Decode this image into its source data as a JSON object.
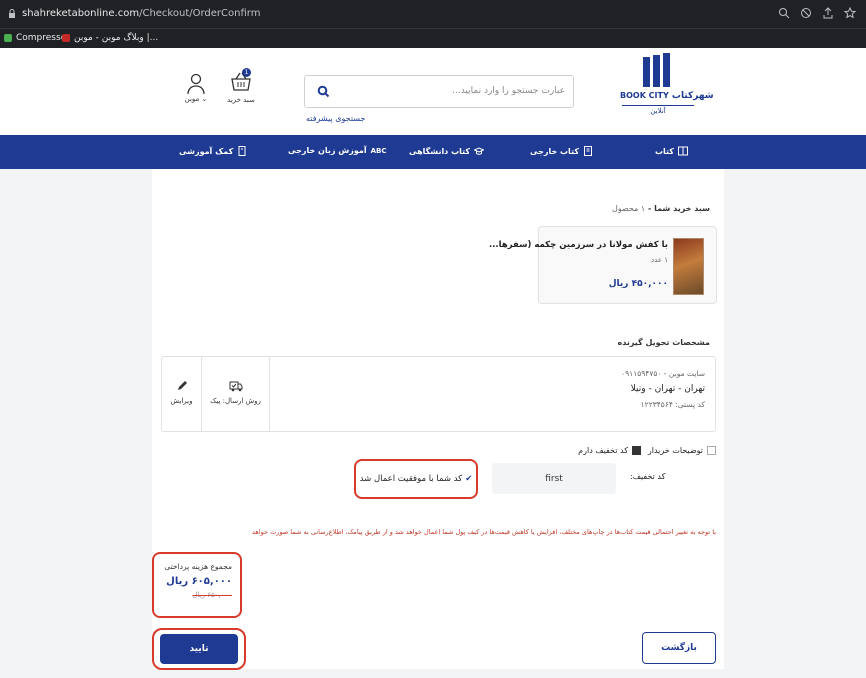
{
  "browser": {
    "url_host": "shahreketabonline.com",
    "url_path": "/Checkout/OrderConfirm",
    "bookmarks": [
      {
        "label": "Compressor",
        "icon": "compressor-icon"
      },
      {
        "label": "وبلاگ موبن - موبن |...",
        "icon": "blog-icon"
      }
    ]
  },
  "header": {
    "logo_fa": "شهرکتاب",
    "logo_en": "BOOK CITY",
    "logo_sub": "آنلاین",
    "search_placeholder": "عبارت جستجو را وارد نمایید...",
    "advanced_search": "جستجوی پیشرفته",
    "cart_label": "سبد خرید",
    "cart_count": "1",
    "account_label": "موبن"
  },
  "nav": {
    "items": [
      {
        "label": "کتاب",
        "icon": "book-icon"
      },
      {
        "label": "کتاب خارجی",
        "icon": "foreign-book-icon"
      },
      {
        "label": "کتاب دانشگاهی",
        "icon": "graduation-icon"
      },
      {
        "label": "آموزش زبان خارجی",
        "icon": "abc-icon"
      },
      {
        "label": "کمک آموزشی",
        "icon": "notebook-icon"
      }
    ]
  },
  "cart": {
    "title": "سبد خرید شما",
    "count_text": "۱ محصول",
    "product_name": "با کفش مولانا در سرزمین چکمه (سفرها...",
    "product_qty": "۱ عدد",
    "product_price": "۴۵۰,۰۰۰ ریال"
  },
  "delivery": {
    "title": "مشخصات تحویل گیرنده",
    "recipient": "سایت موبن - ۰۹۱۱۵۹۴۷۵۰",
    "address": "تهران - تهران - ونیلا",
    "postal": "کد پستی: ۱۲۲۳۴۵۶۴",
    "method_label": "روش ارسال: پیک",
    "edit_label": "ویرایش"
  },
  "options": {
    "buyer_notes_label": "توضیحات خریدار",
    "buyer_notes_checked": false,
    "has_coupon_label": "کد تخفیف دارم",
    "has_coupon_checked": true,
    "coupon_label": "کد تخفیف:",
    "coupon_value": "first",
    "coupon_success": "کد شما با موفقیت اعمال شد"
  },
  "notice": "با توجه به تغییر احتمالی قیمت کتاب‌ها در چاپ‌های مختلف، افزایش یا کاهش قیمت‌ها در کیف پول شما اعمال خواهد شد و از طریق پیامک، اطلاع‌رسانی به شما صورت خواهد گرفت.",
  "summary": {
    "total_label": "مجموع هزینه پرداختی",
    "total_value": "۶۰۵,۰۰۰ ریال",
    "old_value": "۶۵۰,۰۰۰ ریال"
  },
  "actions": {
    "confirm": "تایید",
    "back": "بازگشت"
  },
  "colors": {
    "brand": "#1f3a93",
    "highlight": "#d83a2c"
  }
}
